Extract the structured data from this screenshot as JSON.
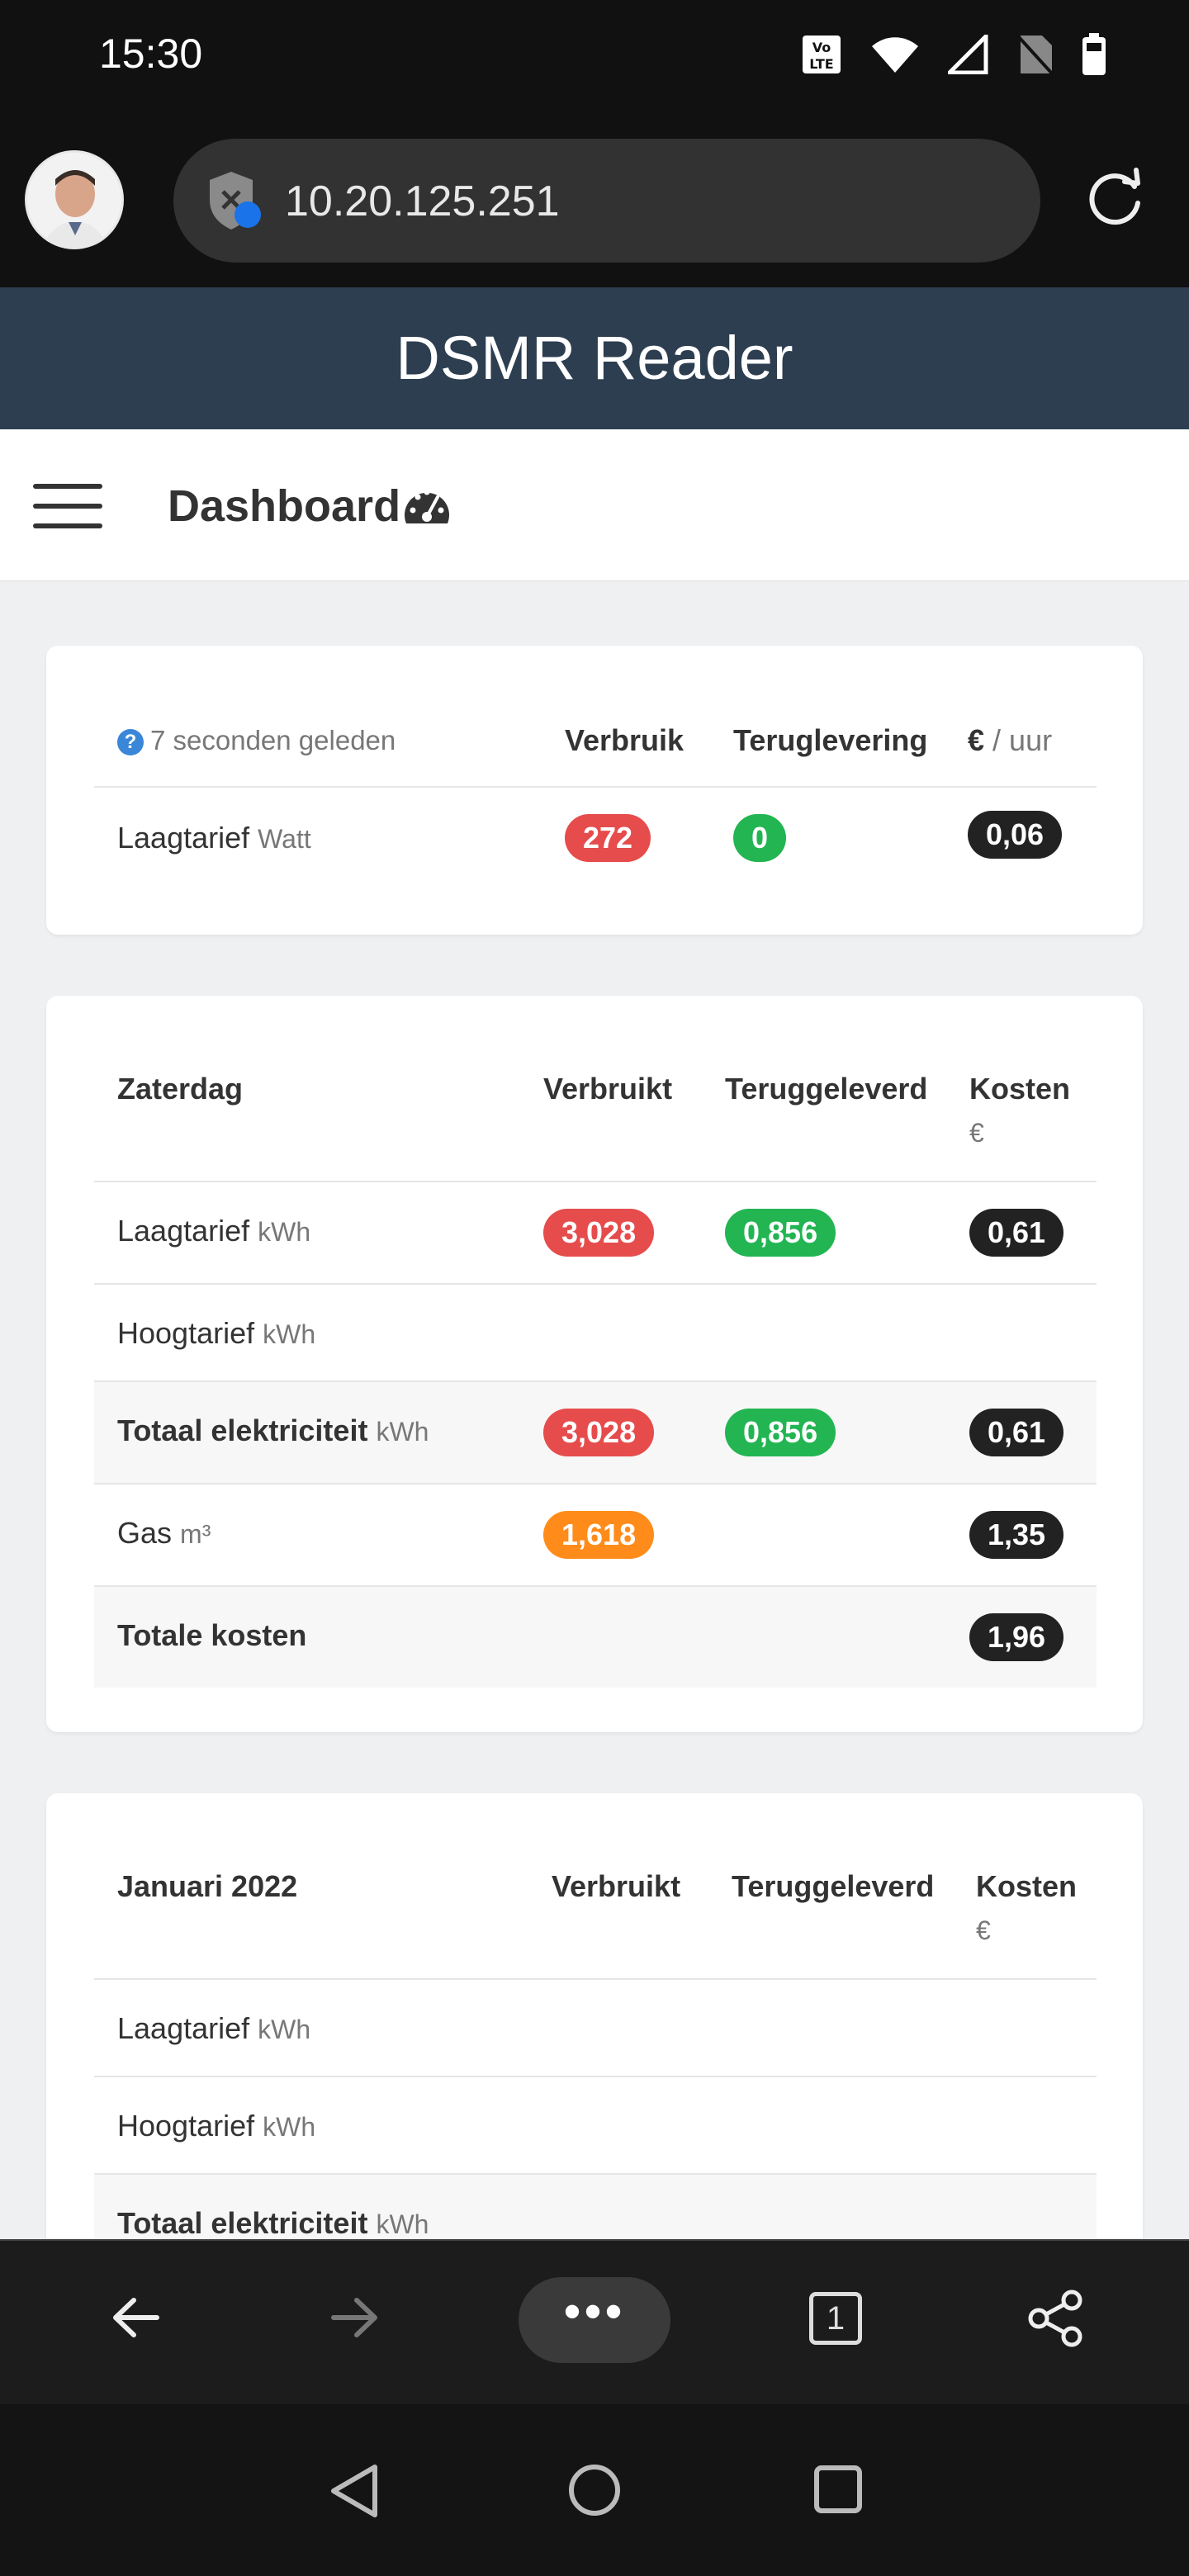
{
  "statusbar": {
    "time": "15:30",
    "volte_label": "Vo LTE"
  },
  "browser": {
    "url": "10.20.125.251",
    "tab_count": "1",
    "more_label": "•••"
  },
  "site": {
    "title": "DSMR Reader"
  },
  "page": {
    "title": "Dashboard"
  },
  "live": {
    "updated": "7 seconden geleden",
    "columns": [
      "Verbruik",
      "Teruglevering"
    ],
    "cost_header_symbol": "€",
    "cost_header_unit": "/ uur",
    "row_label": "Laagtarief",
    "row_unit": "Watt",
    "consumption": "272",
    "delivery": "0",
    "cost": "0,06"
  },
  "today": {
    "title": "Zaterdag",
    "columns": [
      "Verbruikt",
      "Teruggeleverd",
      "Kosten"
    ],
    "cost_unit": "€",
    "rows": [
      {
        "label": "Laagtarief",
        "unit": "kWh",
        "consumption": "3,028",
        "delivery": "0,856",
        "cost": "0,61"
      },
      {
        "label": "Hoogtarief",
        "unit": "kWh"
      },
      {
        "label": "Totaal elektriciteit",
        "unit": "kWh",
        "consumption": "3,028",
        "delivery": "0,856",
        "cost": "0,61"
      },
      {
        "label": "Gas",
        "unit": "m³",
        "consumption": "1,618",
        "cost": "1,35"
      },
      {
        "label": "Totale kosten",
        "cost": "1,96"
      }
    ]
  },
  "month": {
    "title": "Januari 2022",
    "columns": [
      "Verbruikt",
      "Teruggeleverd",
      "Kosten"
    ],
    "cost_unit": "€",
    "rows": [
      {
        "label": "Laagtarief",
        "unit": "kWh"
      },
      {
        "label": "Hoogtarief",
        "unit": "kWh"
      },
      {
        "label": "Totaal elektriciteit",
        "unit": "kWh"
      }
    ]
  },
  "colors": {
    "site_header": "#2c3e50",
    "consumption": "#e64c4c",
    "delivery": "#22b552",
    "gas": "#ff8c1a",
    "cost": "#222222"
  },
  "icons": [
    "volte-icon",
    "wifi-icon",
    "signal-icon",
    "no-sim-icon",
    "battery-icon",
    "shield-icon",
    "reload-icon",
    "menu-icon",
    "dashboard-gauge-icon",
    "help-icon",
    "back-icon",
    "forward-icon",
    "tabs-icon",
    "share-icon",
    "nav-back-icon",
    "nav-home-icon",
    "nav-recents-icon"
  ]
}
